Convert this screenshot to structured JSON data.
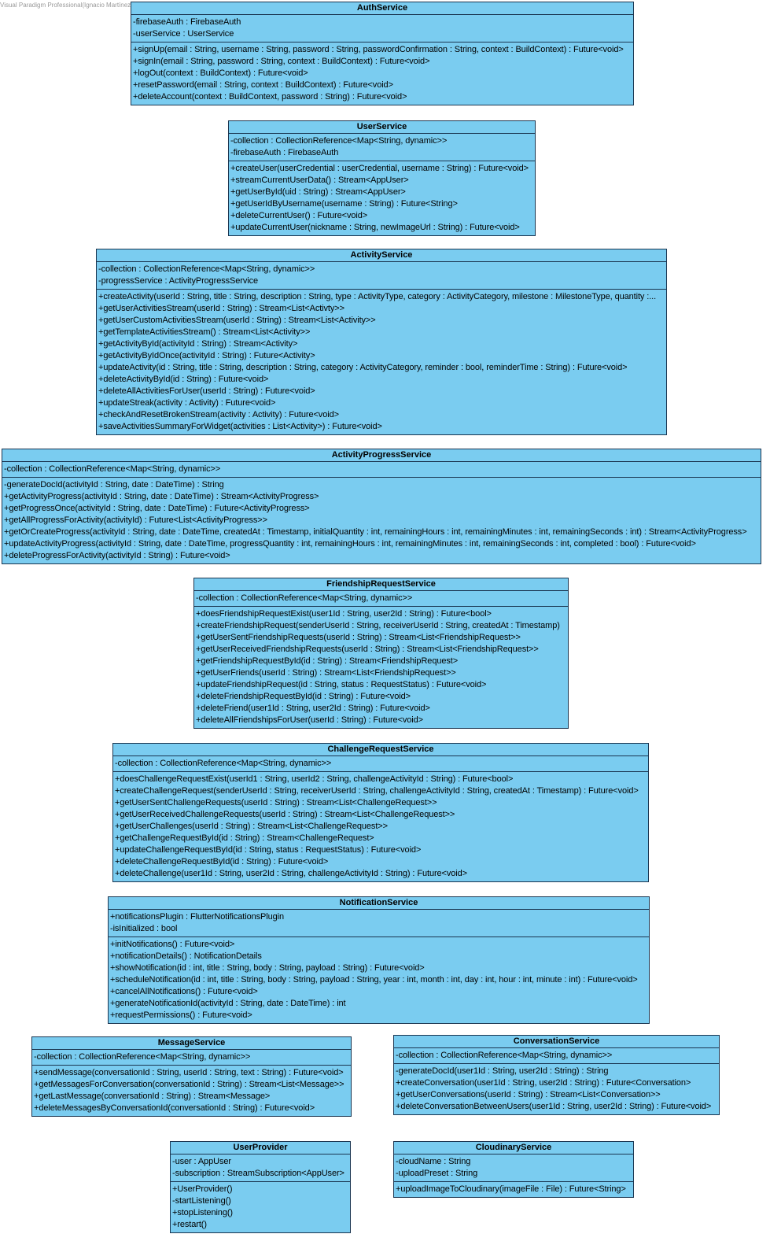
{
  "watermark": "Visual Paradigm Professional(Ignacio Martínez Gallardo(Universidad de Málaga))",
  "classes": [
    {
      "id": "auth-service",
      "name": "AuthService",
      "attributes": [
        "-firebaseAuth : FirebaseAuth",
        "-userService : UserService"
      ],
      "operations": [
        "+signUp(email : String, username : String, password : String, passwordConfirmation : String, context : BuildContext) : Future<void>",
        "+signIn(email : String, password : String, context : BuildContext) : Future<void>",
        "+logOut(context : BuildContext) : Future<void>",
        "+resetPassword(email : String, context : BuildContext) : Future<void>",
        "+deleteAccount(context : BuildContext, password : String) : Future<void>"
      ]
    },
    {
      "id": "user-service",
      "name": "UserService",
      "attributes": [
        "-collection : CollectionReference<Map<String, dynamic>>",
        "-firebaseAuth : FirebaseAuth"
      ],
      "operations": [
        "+createUser(userCredential : userCredential, username : String) : Future<void>",
        "+streamCurrentUserData() : Stream<AppUser>",
        "+getUserById(uid : String) : Stream<AppUser>",
        "+getUserIdByUsername(username : String) : Future<String>",
        "+deleteCurrentUser() : Future<void>",
        "+updateCurrentUser(nickname : String, newImageUrl : String) : Future<void>"
      ]
    },
    {
      "id": "activity-service",
      "name": "ActivityService",
      "attributes": [
        "-collection : CollectionReference<Map<String, dynamic>>",
        "-progressService : ActivityProgressService"
      ],
      "operations": [
        "+createActivity(userId : String, title : String, description : String, type : ActivityType, category : ActivityCategory, milestone : MilestoneType, quantity :...",
        "+getUserActivitiesStream(userId : String) : Stream<List<Activty>>",
        "+getUserCustomActivitiesStream(userId : String) : Stream<List<Activity>>",
        "+getTemplateActivitiesStream() : Stream<List<Activity>>",
        "+getActivityById(activityId : String) : Stream<Activity>",
        "+getActivityByIdOnce(activityId : String) : Future<Activity>",
        "+updateActivity(id : String, title : String, description : String, category : ActivityCategory, reminder : bool, reminderTime : String) : Future<void>",
        "+deleteActivityById(id : String) : Future<void>",
        "+deleteAllActivitiesForUser(userId : String) : Future<void>",
        "+updateStreak(activity : Activity) : Future<void>",
        "+checkAndResetBrokenStream(activity : Activity) : Future<void>",
        "+saveActivitiesSummaryForWidget(activities : List<Activity>) : Future<void>"
      ]
    },
    {
      "id": "activity-progress-service",
      "name": "ActivityProgressService",
      "attributes": [
        "-collection : CollectionReference<Map<String, dynamic>>"
      ],
      "operations": [
        "-generateDocId(activityId : String, date : DateTime) : String",
        "+getActivityProgress(activityId : String, date : DateTime) : Stream<ActivityProgress>",
        "+getProgressOnce(activityId : String, date : DateTime) : Future<ActivityProgress>",
        "+getAllProgressForActivity(activityId) : Future<List<ActivityProgress>>",
        "+getOrCreateProgress(activityId : String, date : DateTime, createdAt : Timestamp, initialQuantity : int, remainingHours : int, remainingMinutes : int, remainingSeconds : int) : Stream<ActivityProgress>",
        "+updateActivityProgress(activityId : String, date : DateTime, progressQuantity : int, remainingHours : int, remainingMinutes : int, remainingSeconds : int, completed : bool) : Future<void>",
        "+deleteProgressForActivity(activityId : String) : Future<void>"
      ]
    },
    {
      "id": "friendship-request-service",
      "name": "FriendshipRequestService",
      "attributes": [
        "-collection : CollectionReference<Map<String, dynamic>>"
      ],
      "operations": [
        "+doesFriendshipRequestExist(user1Id : String, user2Id : String) : Future<bool>",
        "+createFriendshipRequest(senderUserId : String, receiverUserId : String, createdAt : Timestamp)",
        "+getUserSentFriendshipRequests(userId : String) : Stream<List<FriendshipRequest>>",
        "+getUserReceivedFriendshipRequests(userId : String) : Stream<List<FriendshipRequest>>",
        "+getFriendshipRequestById(id : String) : Stream<FriendshipRequest>",
        "+getUserFriends(userId : String) : Stream<List<FriendshipRequest>>",
        "+updateFriendshipRequest(id : String, status : RequestStatus) : Future<void>",
        "+deleteFriendshipRequestById(id : String) : Future<void>",
        "+deleteFriend(user1Id : String, user2Id : String) : Future<void>",
        "+deleteAllFriendshipsForUser(userId : String) : Future<void>"
      ]
    },
    {
      "id": "challenge-request-service",
      "name": "ChallengeRequestService",
      "attributes": [
        "-collection : CollectionReference<Map<String, dynamic>>"
      ],
      "operations": [
        "+doesChallengeRequestExist(userId1 : String, userId2 : String, challengeActivityId : String) : Future<bool>",
        "+createChallengeRequest(senderUserId : String, receiverUserId : String, challengeActivityId : String, createdAt : Timestamp) : Future<void>",
        "+getUserSentChallengeRequests(userId : String) : Stream<List<ChallengeRequest>>",
        "+getUserReceivedChallengeRequests(userId : String) : Stream<List<ChallengeRequest>>",
        "+getUserChallenges(userId : String) : Stream<List<ChallengeRequest>>",
        "+getChallengeRequestById(id : String) : Stream<ChallengeRequest>",
        "+updateChallengeRequestById(id : String, status : RequestStatus) : Future<void>",
        "+deleteChallengeRequestById(id : String) : Future<void>",
        "+deleteChallenge(user1Id : String, user2Id : String, challengeActivityId : String) : Future<void>"
      ]
    },
    {
      "id": "notification-service",
      "name": "NotificationService",
      "attributes": [
        "+notificationsPlugin : FlutterNotificationsPlugin",
        "-isInitialized : bool"
      ],
      "operations": [
        "+initNotifications() : Future<void>",
        "+notificationDetails() : NotificationDetails",
        "+showNotification(id : int, title : String, body : String, payload : String) : Future<void>",
        "+scheduleNotification(id : int, title : String, body : String, payload : String, year : int, month : int, day : int, hour : int, minute : int) : Future<void>",
        "+cancelAllNotifications() : Future<void>",
        "+generateNotificationId(activityId : String, date : DateTime) : int",
        "+requestPermissions() : Future<void>"
      ]
    },
    {
      "id": "message-service",
      "name": "MessageService",
      "attributes": [
        "-collection : CollectionReference<Map<String, dynamic>>"
      ],
      "operations": [
        "+sendMessage(conversationId : String, userId : String, text : String) : Future<void>",
        "+getMessagesForConversation(conversationId : String) : Stream<List<Message>>",
        "+getLastMessage(conversationId : String) : Stream<Message>",
        "+deleteMessagesByConversationId(conversationId : String) : Future<void>"
      ]
    },
    {
      "id": "conversation-service",
      "name": "ConversationService",
      "attributes": [
        "-collection : CollectionReference<Map<String, dynamic>>"
      ],
      "operations": [
        "-generateDocId(user1Id : String, user2Id : String) : String",
        "+createConversation(user1Id : String, user2Id : String) : Future<Conversation>",
        "+getUserConversations(userId : String) : Stream<List<Conversation>>",
        "+deleteConversationBetweenUsers(user1Id : String, user2Id : String) : Future<void>"
      ]
    },
    {
      "id": "user-provider",
      "name": "UserProvider",
      "attributes": [
        "-user : AppUser",
        "-subscription : StreamSubscription<AppUser>"
      ],
      "operations": [
        "+UserProvider()",
        "-startListening()",
        "+stopListening()",
        "+restart()"
      ]
    },
    {
      "id": "cloudinary-service",
      "name": "CloudinaryService",
      "attributes": [
        "-cloudName : String",
        "-uploadPreset : String"
      ],
      "operations": [
        "+uploadImageToCloudinary(imageFile : File) : Future<String>"
      ]
    }
  ]
}
